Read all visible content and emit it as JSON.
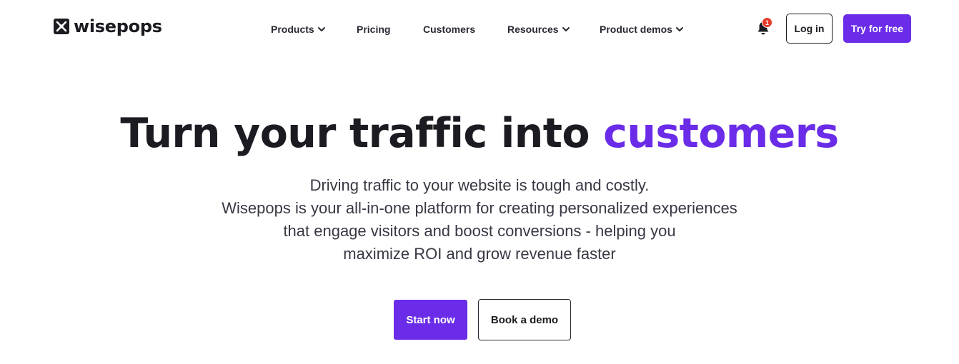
{
  "brand": {
    "name": "wisepops",
    "logo_icon": "wisepops-logo-icon",
    "accent_color": "#6a2ce8",
    "text_color": "#1d1b22",
    "badge_color": "#e5392a"
  },
  "nav": {
    "items": [
      {
        "label": "Products",
        "has_dropdown": true
      },
      {
        "label": "Pricing",
        "has_dropdown": false
      },
      {
        "label": "Customers",
        "has_dropdown": false
      },
      {
        "label": "Resources",
        "has_dropdown": true
      },
      {
        "label": "Product demos",
        "has_dropdown": true
      }
    ]
  },
  "header": {
    "notifications_icon": "bell-icon",
    "notifications_count": "1",
    "login_label": "Log in",
    "try_label": "Try for free"
  },
  "hero": {
    "title_main": "Turn your traffic into",
    "title_accent": "customers",
    "subtitle_lines": [
      "Driving traffic to your website is tough and costly.",
      "Wisepops is your all-in-one platform for creating personalized experiences",
      "that engage visitors and boost conversions - helping you",
      "maximize ROI and grow revenue faster"
    ],
    "primary_cta": "Start now",
    "secondary_cta": "Book a demo"
  }
}
